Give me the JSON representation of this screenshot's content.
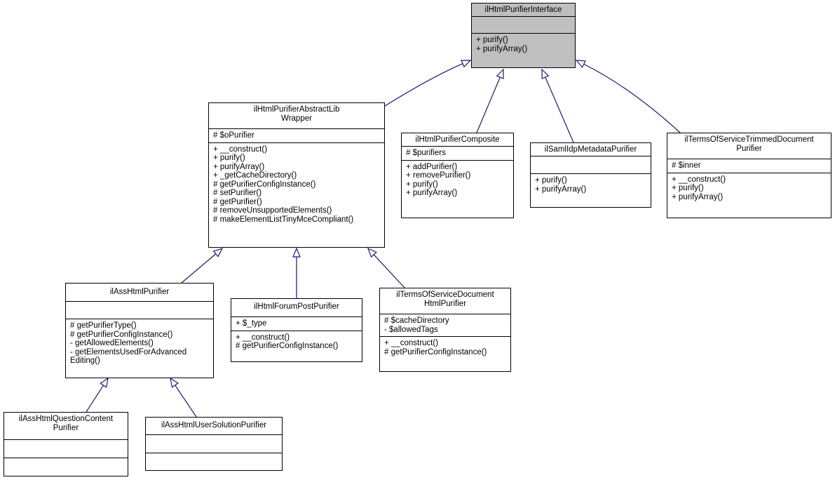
{
  "diagram": {
    "type": "uml-class-inheritance",
    "edge_color": "#191970",
    "highlight_color": "#bfbfbf",
    "classes": [
      {
        "id": "iface",
        "title": "ilHtmlPurifierInterface",
        "attributes": [],
        "methods": [
          "+ purify()",
          "+ purifyArray()"
        ],
        "highlighted": true
      },
      {
        "id": "abstract",
        "title": "ilHtmlPurifierAbstractLib\nWrapper",
        "attributes": [
          "# $oPurifier"
        ],
        "methods": [
          "+ __construct()",
          "+ purify()",
          "+ purifyArray()",
          "+ _getCacheDirectory()",
          "# getPurifierConfigInstance()",
          "# setPurifier()",
          "# getPurifier()",
          "# removeUnsupportedElements()",
          "# makeElementListTinyMceCompliant()"
        ]
      },
      {
        "id": "composite",
        "title": "ilHtmlPurifierComposite",
        "attributes": [
          "# $purifiers"
        ],
        "methods": [
          "+ addPurifier()",
          "+ removePurifier()",
          "+ purify()",
          "+ purifyArray()"
        ]
      },
      {
        "id": "saml",
        "title": "ilSamlIdpMetadataPurifier",
        "attributes": [],
        "methods": [
          "+ purify()",
          "+ purifyArray()"
        ]
      },
      {
        "id": "tostrim",
        "title": "ilTermsOfServiceTrimmedDocument\nPurifier",
        "attributes": [
          "# $inner"
        ],
        "methods": [
          "+ __construct()",
          "+ purify()",
          "+ purifyArray()"
        ]
      },
      {
        "id": "ass",
        "title": "ilAssHtmlPurifier",
        "attributes": [],
        "methods": [
          "# getPurifierType()",
          "# getPurifierConfigInstance()",
          "- getAllowedElements()",
          "- getElementsUsedForAdvanced\nEditing()"
        ]
      },
      {
        "id": "forum",
        "title": "ilHtmlForumPostPurifier",
        "attributes": [
          "+ $_type"
        ],
        "methods": [
          "+ __construct()",
          "# getPurifierConfigInstance()"
        ]
      },
      {
        "id": "tosdoc",
        "title": "ilTermsOfServiceDocument\nHtmlPurifier",
        "attributes": [
          "# $cacheDirectory",
          "- $allowedTags"
        ],
        "methods": [
          "+ __construct()",
          "# getPurifierConfigInstance()"
        ]
      },
      {
        "id": "question",
        "title": "ilAssHtmlQuestionContent\nPurifier",
        "attributes": [],
        "methods": []
      },
      {
        "id": "usersol",
        "title": "ilAssHtmlUserSolutionPurifier",
        "attributes": [],
        "methods": []
      }
    ],
    "inherits": [
      {
        "child": "abstract",
        "parent": "iface"
      },
      {
        "child": "composite",
        "parent": "iface"
      },
      {
        "child": "saml",
        "parent": "iface"
      },
      {
        "child": "tostrim",
        "parent": "iface"
      },
      {
        "child": "ass",
        "parent": "abstract"
      },
      {
        "child": "forum",
        "parent": "abstract"
      },
      {
        "child": "tosdoc",
        "parent": "abstract"
      },
      {
        "child": "question",
        "parent": "ass"
      },
      {
        "child": "usersol",
        "parent": "ass"
      }
    ]
  }
}
